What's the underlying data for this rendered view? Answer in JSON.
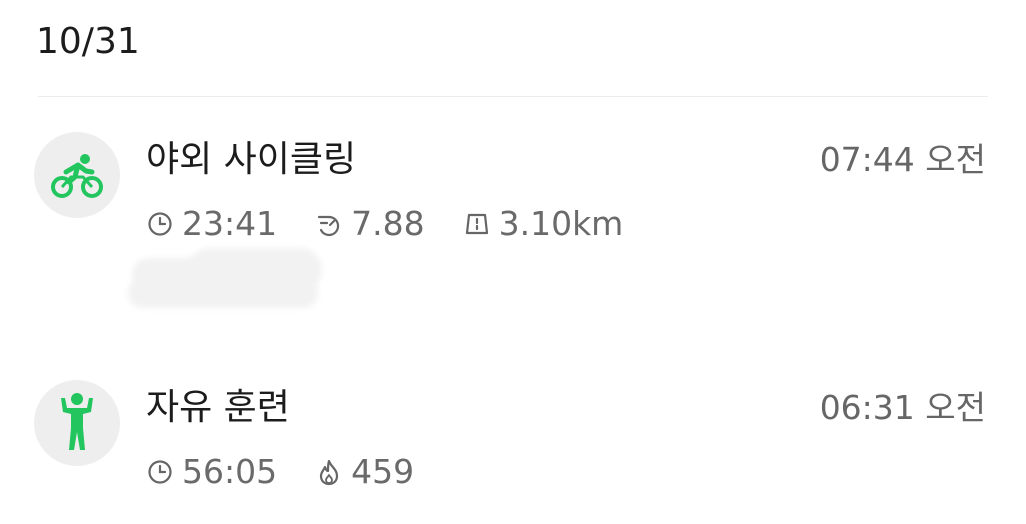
{
  "date_header": "10/31",
  "accent_color": "#22c55e",
  "workouts": [
    {
      "icon": "cycling-icon",
      "title": "야외 사이클링",
      "time": "07:44 오전",
      "stats": [
        {
          "icon": "clock-icon",
          "value": "23:41"
        },
        {
          "icon": "speed-icon",
          "value": "7.88"
        },
        {
          "icon": "road-icon",
          "value": "3.10km"
        }
      ]
    },
    {
      "icon": "standing-person-icon",
      "title": "자유 훈련",
      "time": "06:31 오전",
      "stats": [
        {
          "icon": "clock-icon",
          "value": "56:05"
        },
        {
          "icon": "flame-icon",
          "value": "459"
        }
      ]
    }
  ]
}
